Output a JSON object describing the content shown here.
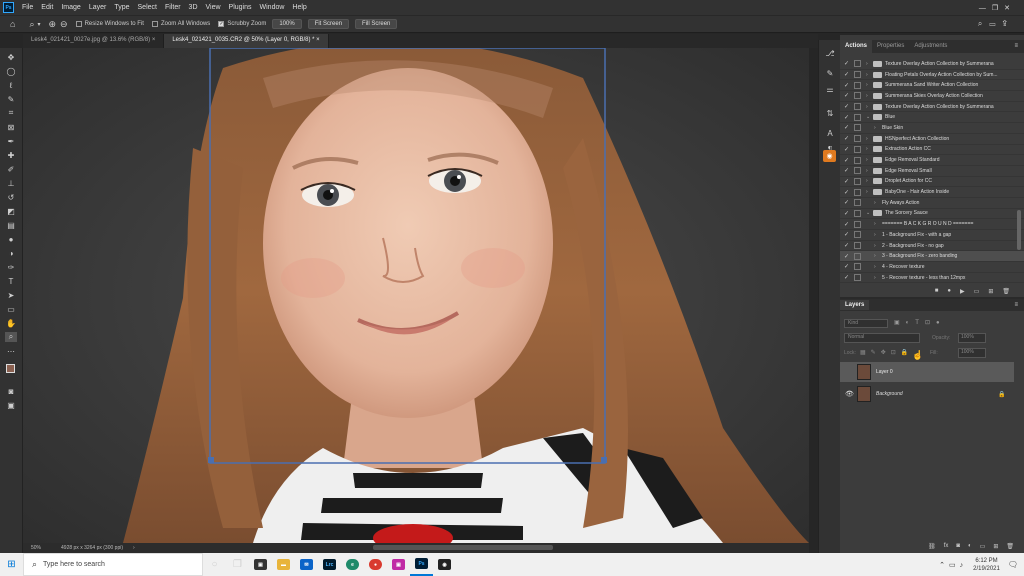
{
  "menubar": {
    "logo": "Ps",
    "items": [
      "File",
      "Edit",
      "Image",
      "Layer",
      "Type",
      "Select",
      "Filter",
      "3D",
      "View",
      "Plugins",
      "Window",
      "Help"
    ]
  },
  "options": {
    "resize_windows": "Resize Windows to Fit",
    "zoom_all": "Zoom All Windows",
    "scrubby_zoom": "Scrubby Zoom",
    "zoom_100": "100%",
    "fit_screen": "Fit Screen",
    "fill_screen": "Fill Screen"
  },
  "tabs": [
    {
      "label": "Lesk4_021421_0027e.jpg @ 13.6% (RGB/8) ×"
    },
    {
      "label": "Lesk4_021421_0035.CR2 @ 50% (Layer 0, RGB/8) * ×"
    }
  ],
  "status": {
    "zoom": "50%",
    "info": "4928 px x 3264 px (300 ppi)"
  },
  "actions_panel": {
    "tabs": [
      "Actions",
      "Properties",
      "Adjustments"
    ],
    "rows": [
      {
        "label": "Texture Overlay Action Collection by Summerana",
        "type": "set"
      },
      {
        "label": "Floating Petals Overlay Action Collection by Sum...",
        "type": "set"
      },
      {
        "label": "Summerana Sand Writer Action Collection",
        "type": "set"
      },
      {
        "label": "Summerana Skies Overlay Action Collection",
        "type": "set"
      },
      {
        "label": "Texture Overlay Action Collection by Summerana",
        "type": "set"
      },
      {
        "label": "Blue",
        "type": "set-open"
      },
      {
        "label": "Blue Skin",
        "type": "action"
      },
      {
        "label": "HSNperfect Action Collection",
        "type": "set"
      },
      {
        "label": "Extraction Action CC",
        "type": "set"
      },
      {
        "label": "Edge Removal Standard",
        "type": "set"
      },
      {
        "label": "Edge Removal Small",
        "type": "set"
      },
      {
        "label": "Droplet Action for CC",
        "type": "set"
      },
      {
        "label": "BabyOne - Hair Action Inside",
        "type": "set"
      },
      {
        "label": "Fly Aways Action",
        "type": "action"
      },
      {
        "label": "The Sorcery Sauce",
        "type": "set-open"
      },
      {
        "label": "======= B A C K G R O U N D =======",
        "type": "action"
      },
      {
        "label": "1 - Background Fix - with a gap",
        "type": "action"
      },
      {
        "label": "2 - Background Fix - no gap",
        "type": "action"
      },
      {
        "label": "3 - Background Fix - zero banding",
        "type": "action-selected"
      },
      {
        "label": "4 - Recover texture",
        "type": "action"
      },
      {
        "label": "5 - Recover texture - less than 12mpx",
        "type": "action"
      }
    ]
  },
  "layers_panel": {
    "title": "Layers",
    "kind": "Kind",
    "blend_mode": "Normal",
    "opacity_label": "Opacity:",
    "opacity": "100%",
    "lock_label": "Lock:",
    "fill_label": "Fill:",
    "fill": "100%",
    "layers": [
      {
        "name": "Layer 0",
        "selected": true,
        "visible": false
      },
      {
        "name": "Background",
        "selected": false,
        "visible": true,
        "locked": true
      }
    ]
  },
  "taskbar": {
    "search_placeholder": "Type here to search",
    "time": "6:12 PM",
    "date": "2/19/2021"
  }
}
